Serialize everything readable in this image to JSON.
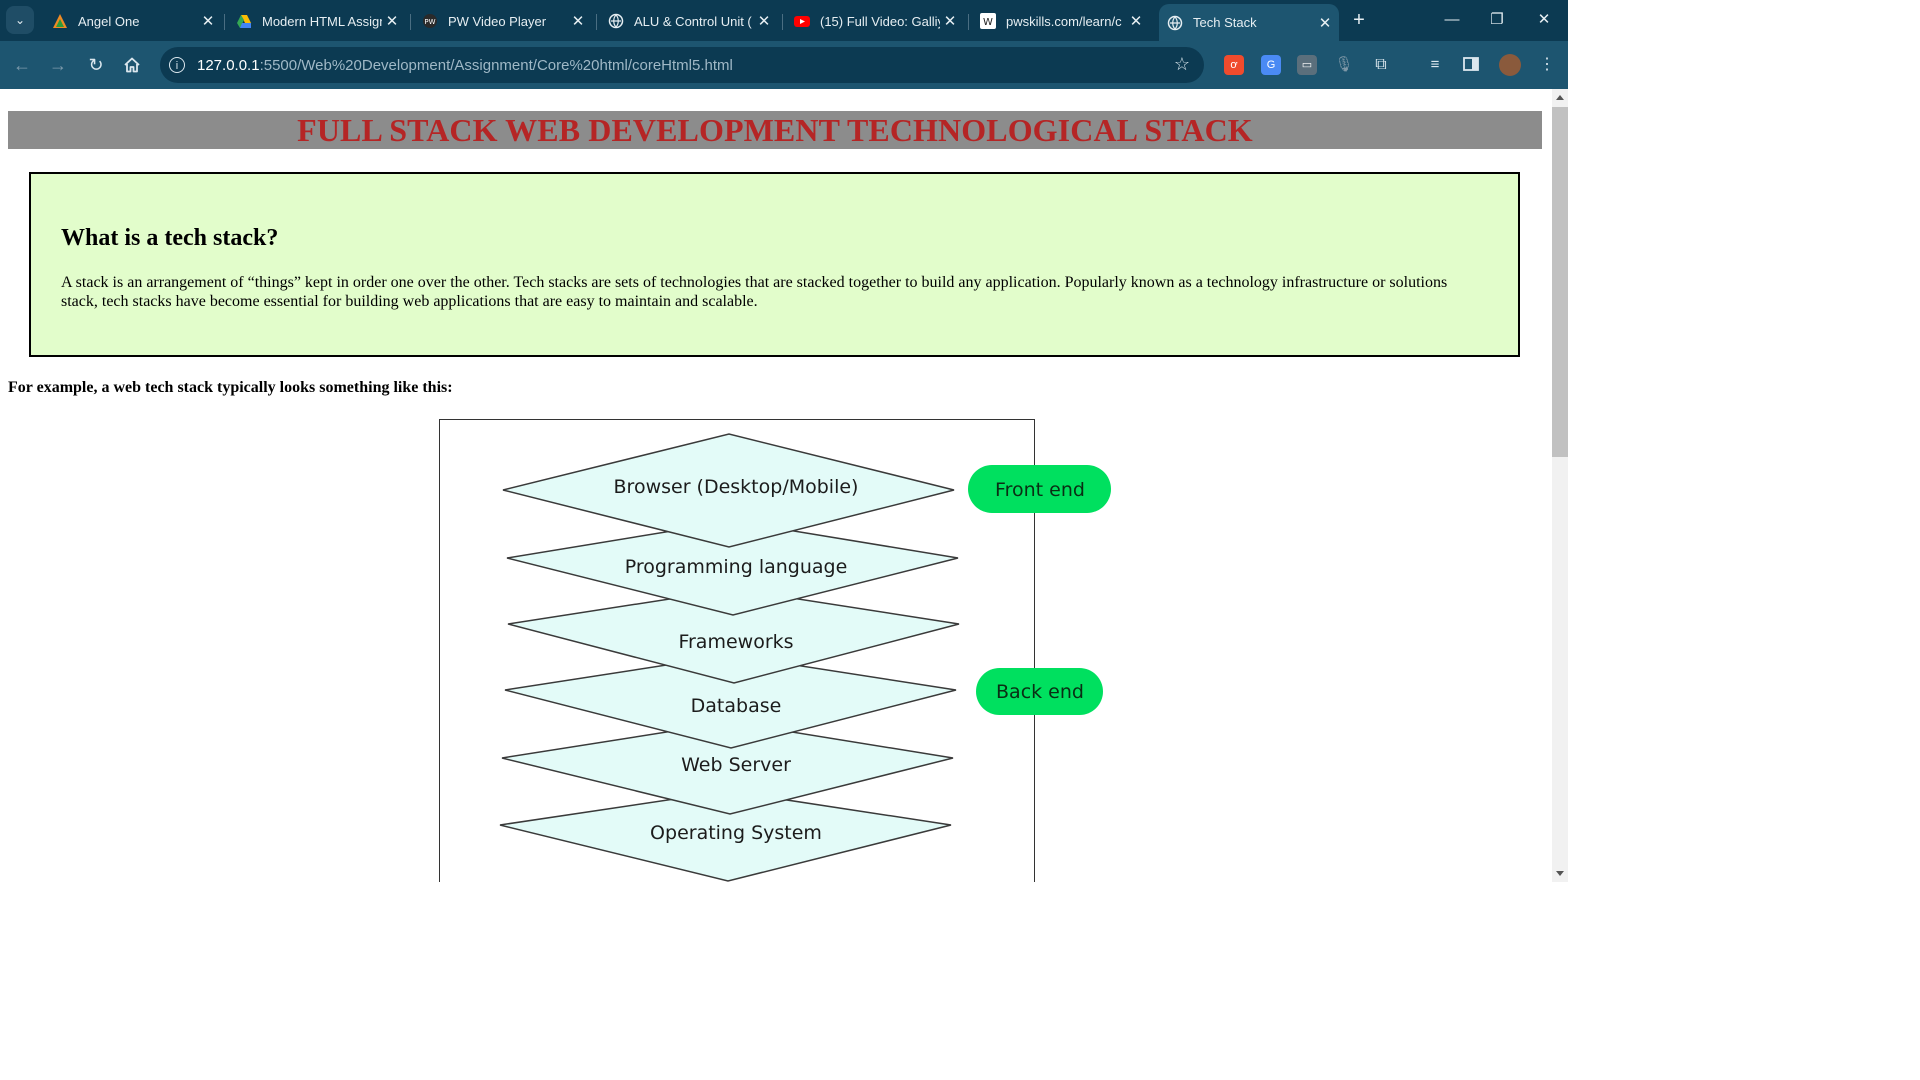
{
  "browser": {
    "tabs": [
      {
        "title": "Angel One",
        "icon": "angel-one-icon"
      },
      {
        "title": "Modern HTML Assign",
        "icon": "google-drive-icon"
      },
      {
        "title": "PW Video Player",
        "icon": "pw-icon"
      },
      {
        "title": "ALU & Control Unit (",
        "icon": "globe-icon"
      },
      {
        "title": "(15) Full Video: Galliy",
        "icon": "youtube-icon"
      },
      {
        "title": "pwskills.com/learn/c",
        "icon": "pwskills-icon"
      },
      {
        "title": "Tech Stack",
        "icon": "globe-icon",
        "active": true
      }
    ],
    "url_host": "127.0.0.1",
    "url_rest": ":5500/Web%20Development/Assignment/Core%20html/coreHtml5.html"
  },
  "page": {
    "banner": "FULL STACK WEB DEVELOPMENT TECHNOLOGICAL STACK",
    "section_heading": "What is a tech stack?",
    "section_text": "A stack is an arrangement of “things” kept in order one over the other. Tech stacks are sets of technologies that are stacked together to build any application. Popularly known as a technology infrastructure or solutions stack, tech stacks have become essential for building web applications that are easy to maintain and scalable.",
    "example_text": "For example, a web tech stack typically looks something like this:"
  },
  "diagram": {
    "layers": [
      "Browser (Desktop/Mobile)",
      "Programming language",
      "Frameworks",
      "Database",
      "Web Server",
      "Operating System"
    ],
    "front_end_label": "Front end",
    "back_end_label": "Back end",
    "colors": {
      "layer_fill": "#e3fbf8",
      "pill": "#00e05f",
      "banner_text": "#b52525",
      "banner_bg": "#8c8c8c",
      "box_bg": "#e2fdcb"
    }
  }
}
